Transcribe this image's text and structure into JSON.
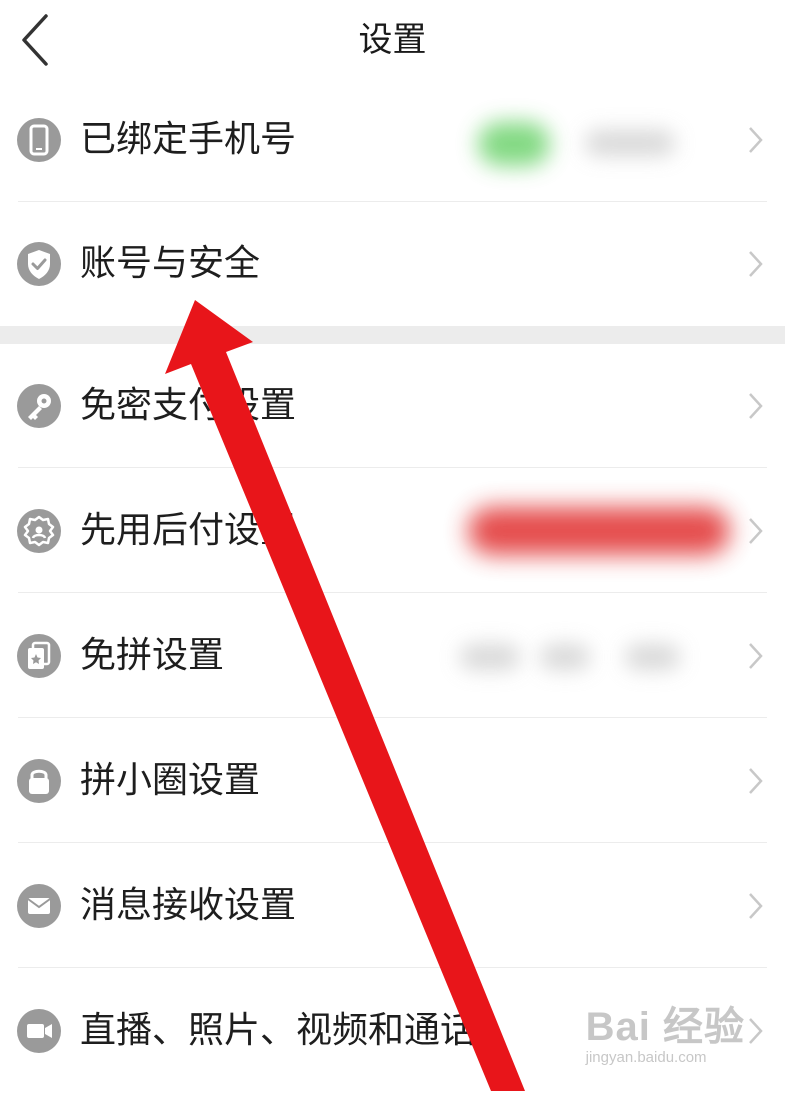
{
  "header": {
    "title": "设置",
    "back_icon": "chevron-left-icon"
  },
  "colors": {
    "icon_bg": "#9a9a9a",
    "separator": "#ececec",
    "section_gap": "#ececec",
    "annotation_arrow": "#e8151a"
  },
  "settings": {
    "items": [
      {
        "label": "已绑定手机号",
        "icon": "phone-icon"
      },
      {
        "label": "账号与安全",
        "icon": "shield-check-icon"
      },
      {
        "label": "免密支付设置",
        "icon": "key-icon"
      },
      {
        "label": "先用后付设置",
        "icon": "badge-icon"
      },
      {
        "label": "免拼设置",
        "icon": "cards-icon"
      },
      {
        "label": "拼小圈设置",
        "icon": "lock-icon"
      },
      {
        "label": "消息接收设置",
        "icon": "envelope-icon"
      },
      {
        "label": "直播、照片、视频和通话",
        "icon": "video-camera-icon"
      }
    ]
  },
  "watermark": {
    "logo": "Bai 经验",
    "url": "jingyan.baidu.com"
  }
}
